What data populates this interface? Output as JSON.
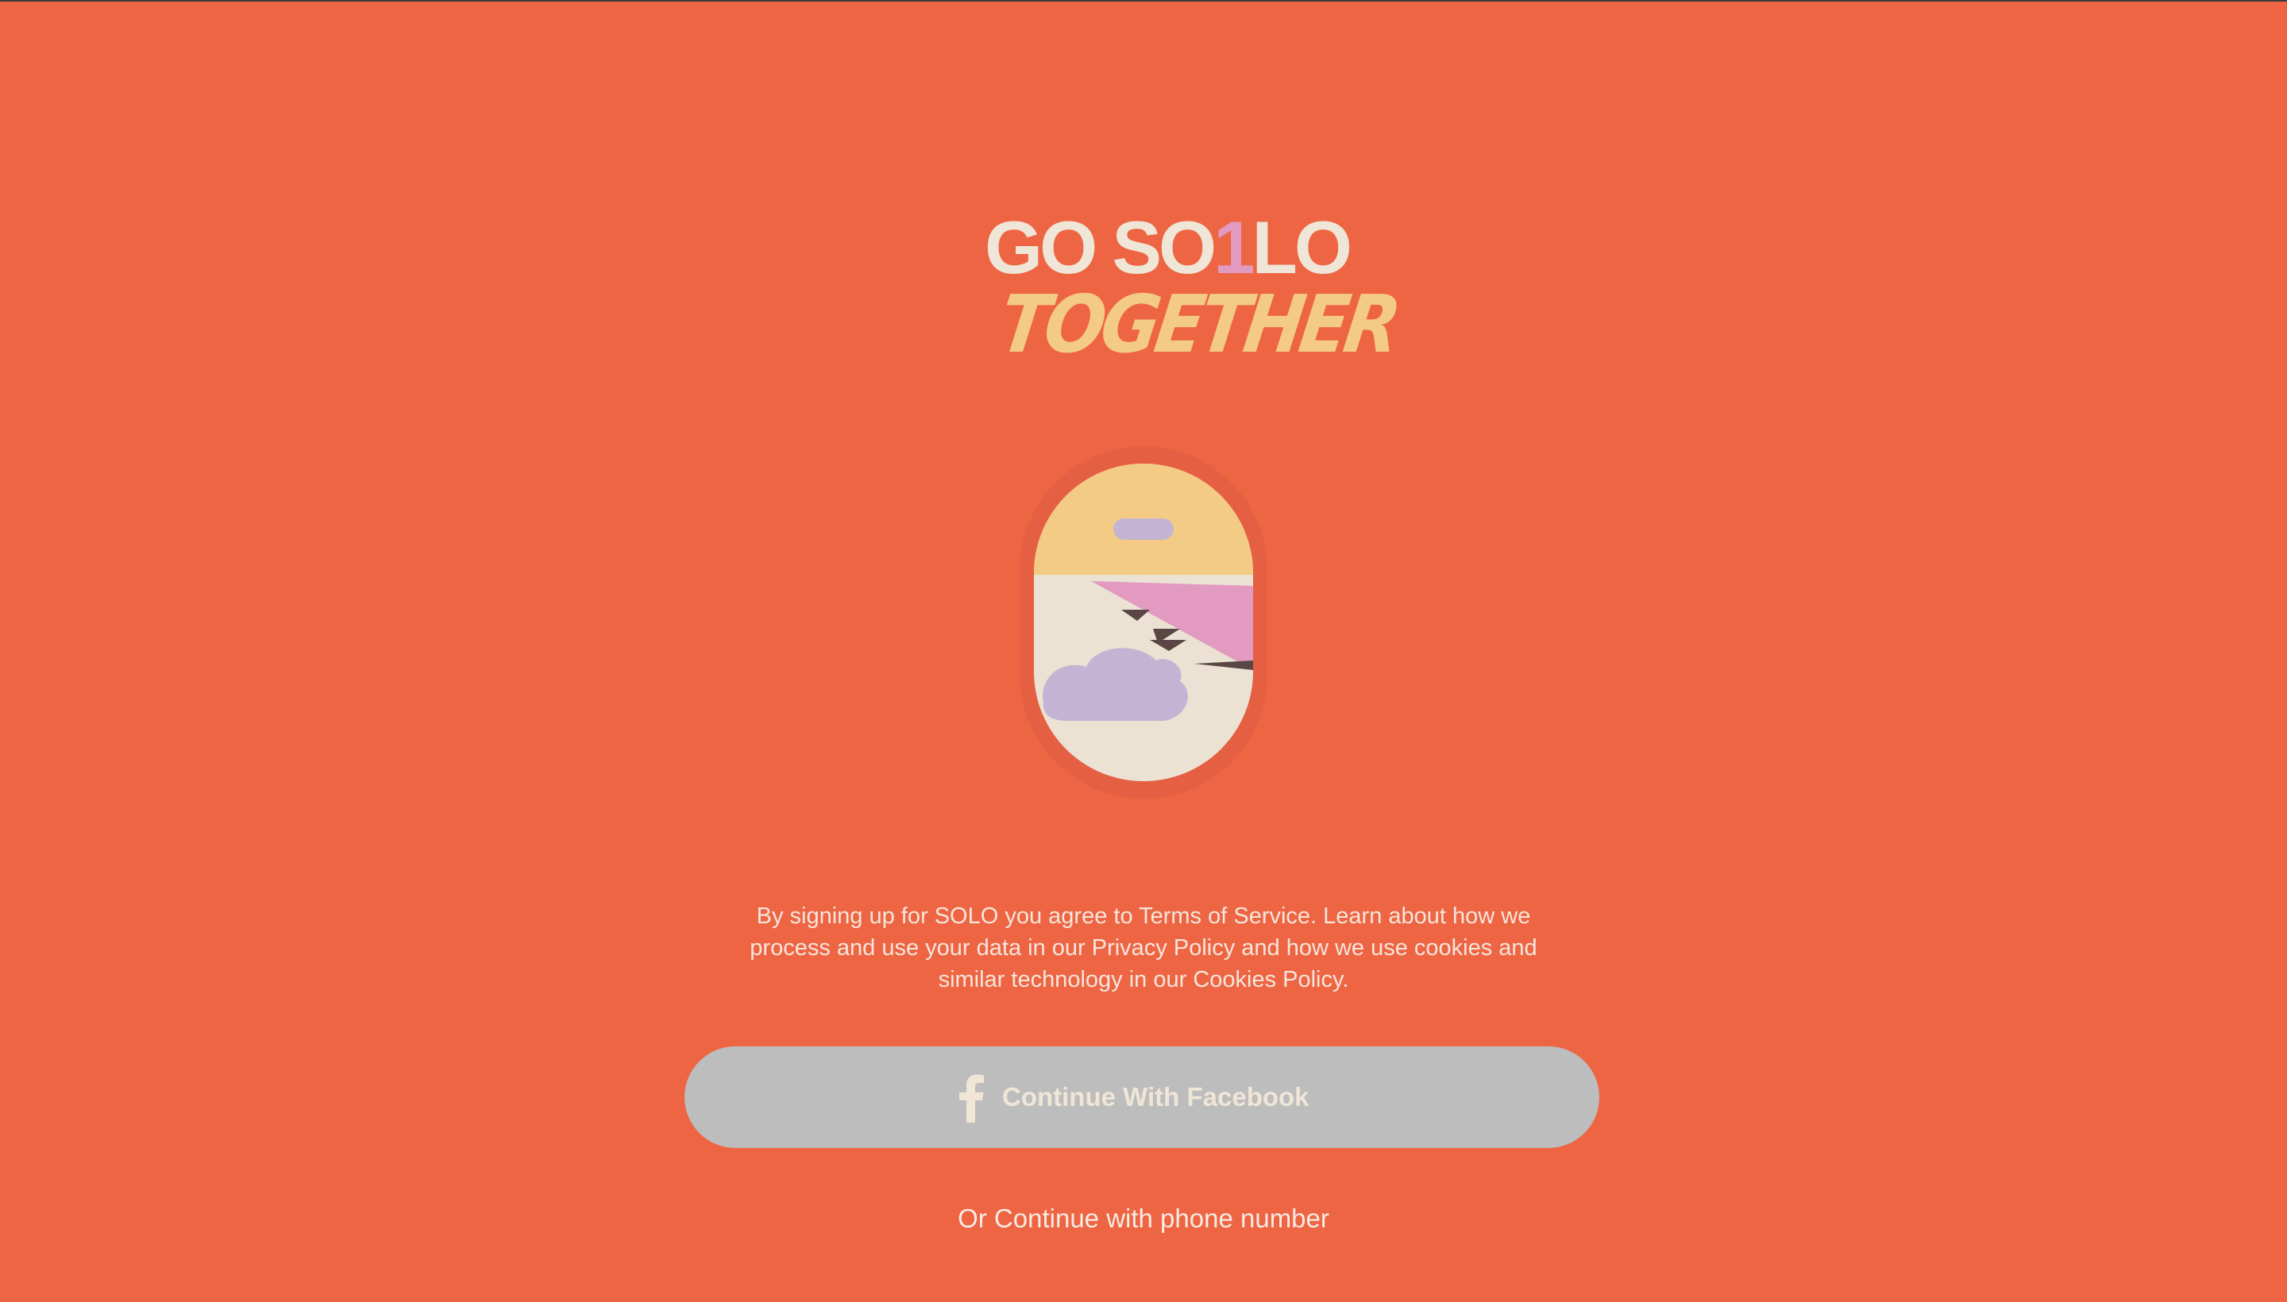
{
  "logo": {
    "line1_start": "GO SO",
    "line1_accent": "1",
    "line1_end": "LO",
    "line2": "TOGETHER"
  },
  "illustration": {
    "icon": "airplane-window-icon"
  },
  "legal": {
    "text": "By signing up for SOLO you agree to Terms of Service. Learn about how we process and use your data in our Privacy Policy and how we use cookies and similar technology in our Cookies Policy."
  },
  "facebook_button": {
    "label": "Continue With Facebook",
    "icon": "facebook-icon"
  },
  "phone_link": {
    "label": "Or Continue with phone number"
  },
  "colors": {
    "background": "#ee6543",
    "cream": "#efe6d7",
    "yellow": "#f4cb84",
    "pink": "#e29ac0",
    "lavender": "#c4b4d4",
    "button_gray": "#bdbdbd"
  }
}
